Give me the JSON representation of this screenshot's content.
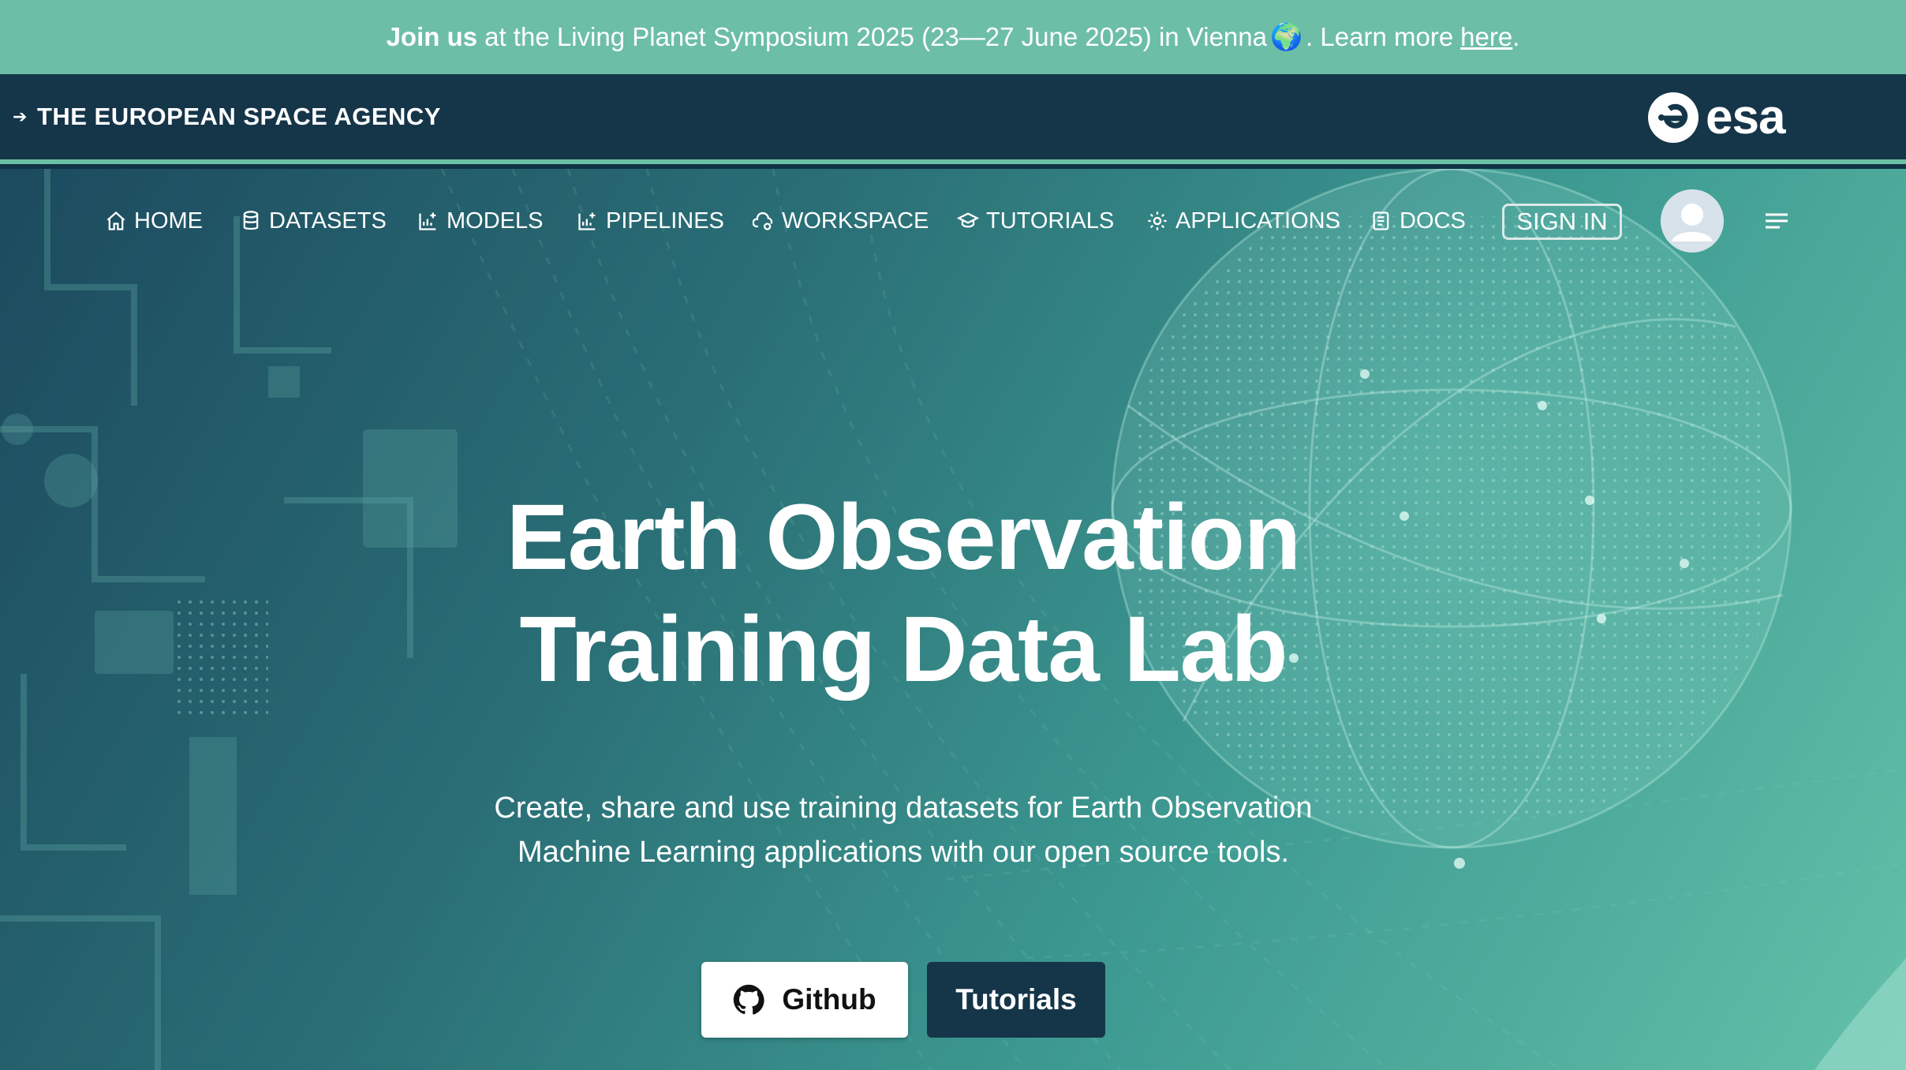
{
  "banner": {
    "strong": "Join us",
    "text": "at the Living Planet Symposium 2025 (23—27 June 2025) in Vienna",
    "globe": "🌍",
    "learn_more": ". Learn more",
    "link": "here",
    "end": "."
  },
  "header": {
    "agency": "THE EUROPEAN SPACE AGENCY",
    "logo_text": "esa"
  },
  "nav": {
    "items": [
      {
        "label": "HOME",
        "icon": "home-icon"
      },
      {
        "label": "DATASETS",
        "icon": "database-icon"
      },
      {
        "label": "MODELS",
        "icon": "chart-add-icon"
      },
      {
        "label": "PIPELINES",
        "icon": "chart-add-icon"
      },
      {
        "label": "WORKSPACE",
        "icon": "cloud-gear-icon"
      },
      {
        "label": "TUTORIALS",
        "icon": "graduation-cap-icon"
      },
      {
        "label": "APPLICATIONS",
        "icon": "gear-icon"
      },
      {
        "label": "DOCS",
        "icon": "document-icon"
      }
    ],
    "signin": "SIGN IN"
  },
  "hero": {
    "title_line1": "Earth Observation",
    "title_line2": "Training Data Lab",
    "subtitle_line1": "Create, share and use training datasets for Earth Observation",
    "subtitle_line2": "Machine Learning applications with our open source tools.",
    "github_label": "Github",
    "tutorials_label": "Tutorials"
  },
  "colors": {
    "banner": "#6dbea6",
    "header": "#153549",
    "accent": "#6dbea6",
    "button_dark": "#153549"
  }
}
